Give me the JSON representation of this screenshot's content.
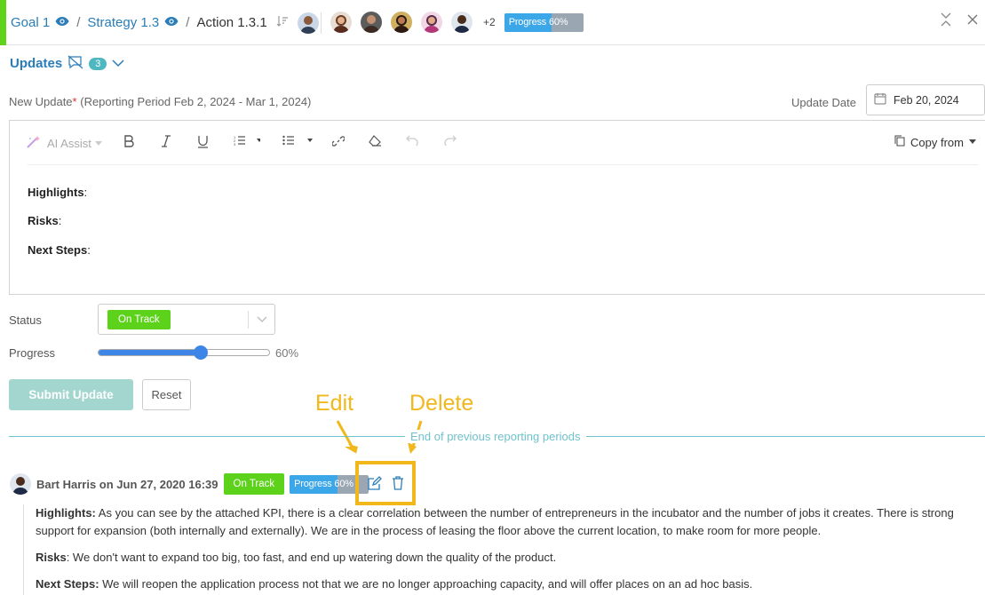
{
  "breadcrumb": {
    "goal": "Goal 1",
    "strategy": "Strategy 1.3",
    "action": "Action 1.3.1",
    "sep": "/"
  },
  "header": {
    "more_count": "+2",
    "progress_label": "Progress 60%",
    "progress_value": 60
  },
  "updates": {
    "title": "Updates",
    "count": "3"
  },
  "form": {
    "new_update_label": "New Update",
    "required_mark": "*",
    "reporting_period": "(Reporting Period Feb 2, 2024 - Mar 1, 2024)",
    "update_date_label": "Update Date",
    "update_date_value": "Feb 20, 2024",
    "ai_assist": "AI Assist",
    "copy_from": "Copy from",
    "editor_lines": {
      "highlights": "Highlights",
      "risks": "Risks",
      "next_steps": "Next Steps",
      "colon": ":"
    },
    "status_label": "Status",
    "status_value": "On Track",
    "progress_label": "Progress",
    "progress_value": 60,
    "progress_text": "60%",
    "submit": "Submit Update",
    "reset": "Reset"
  },
  "annotations": {
    "edit": "Edit",
    "delete": "Delete"
  },
  "divider_text": "End of previous reporting periods",
  "post": {
    "author": "Bart Harris on Jun 27, 2020 16:39",
    "status": "On Track",
    "progress_label": "Progress 60%",
    "progress_value": 60,
    "highlights_label": "Highlights:",
    "highlights_text": " As you can see by the attached KPI, there is a clear correlation between the number of entrepreneurs in the incubator and the number of jobs it creates. There is strong support for expansion (both internally and externally). We are in the process of leasing the floor above the current location, to make room for more people.",
    "risks_label": "Risks",
    "risks_text": ": We don't want to expand too big, too fast, and end up watering down the quality of the product.",
    "next_label": "Next Steps:",
    "next_text": " We will reopen the application process not that we are no longer approaching capacity, and will offer places on an ad hoc basis."
  },
  "colors": {
    "accent": "#5fd31a",
    "link": "#2a7db8",
    "on_track": "#5dd21b",
    "progress": "#3ba6e8",
    "annotation": "#f0b81c",
    "teal": "#6fc2cc"
  },
  "icons": [
    "eye-icon",
    "sort-icon",
    "collapse-icon",
    "close-icon",
    "comment-off-icon",
    "chevron-down-icon",
    "calendar-icon",
    "magic-wand-icon",
    "bold-icon",
    "italic-icon",
    "underline-icon",
    "ordered-list-icon",
    "bullet-list-icon",
    "link-icon",
    "eraser-icon",
    "undo-icon",
    "redo-icon",
    "copy-icon",
    "edit-icon",
    "trash-icon"
  ]
}
